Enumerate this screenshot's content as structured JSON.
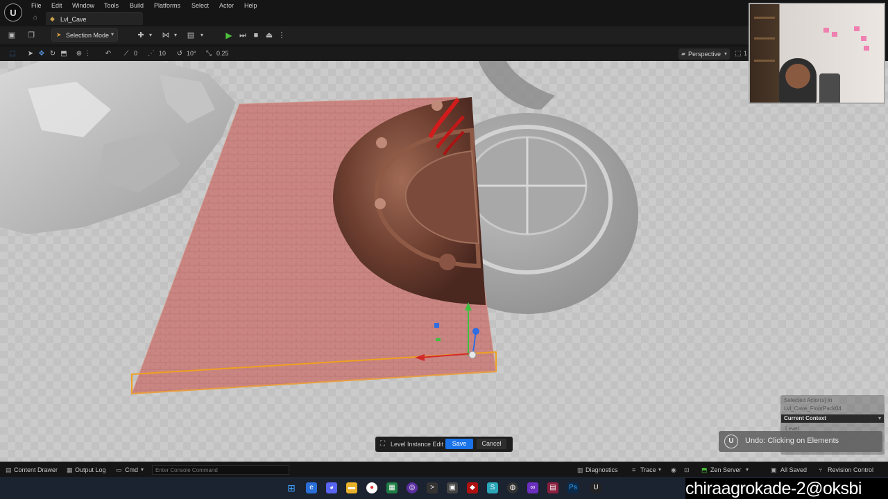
{
  "app": {
    "logo_text": "U",
    "level_tab": "Lvl_Cave"
  },
  "menu": [
    "File",
    "Edit",
    "Window",
    "Tools",
    "Build",
    "Platforms",
    "Select",
    "Actor",
    "Help"
  ],
  "toolbar": {
    "mode_label": "Selection Mode"
  },
  "viewport_toolbar": {
    "rotation_snap": "0",
    "grid_snap": "10",
    "angle_snap": "10°",
    "scale_snap": "0.25",
    "view_mode": "Perspective",
    "extra": "1"
  },
  "selection_panel": {
    "line1": "Selected Actor(s) in",
    "line2": "Lvl_Cave_FloorPack04",
    "context_label": "Current Context",
    "level_label": "Level"
  },
  "undo_toast": {
    "icon": "U",
    "text": "Undo: Clicking on Elements"
  },
  "level_instance_bar": {
    "label": "Level Instance Edit",
    "save": "Save",
    "cancel": "Cancel"
  },
  "axis_gizmo": {
    "x_label": "x"
  },
  "statusbar": {
    "content_drawer": "Content Drawer",
    "output_log": "Output Log",
    "cmd": "Cmd",
    "console_placeholder": "Enter Console Command",
    "diagnostics": "Diagnostics",
    "trace": "Trace",
    "zen_server": "Zen Server",
    "all_saved": "All Saved",
    "revision_control": "Revision Control"
  },
  "watermark": "chiraagrokade-2@oksbi",
  "colors": {
    "floor_tint": "#c97b78",
    "selection_outline": "#f0a020",
    "save_button": "#1a73e8",
    "play_green": "#4cbf3c"
  }
}
